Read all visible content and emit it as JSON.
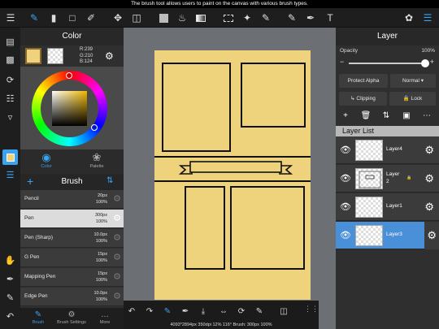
{
  "status_bar": {
    "tip": "The brush tool allows users to paint on the canvas with various brush types."
  },
  "top_toolbar": {
    "icons": [
      "menu-icon",
      "brush-tool-icon",
      "eraser-tool-icon",
      "select-rect-icon",
      "smudge-tool-icon",
      "move-tool-icon",
      "transform-tool-icon",
      "fill-color-icon",
      "bucket-fill-icon",
      "gradient-icon",
      "lasso-select-icon",
      "magic-wand-icon",
      "select-pen-icon",
      "eyedropper-icon",
      "text-tool-icon",
      "materials-icon",
      "layers-toggle-icon"
    ]
  },
  "color_panel": {
    "title": "Color",
    "rgb": {
      "r": "R:239",
      "g": "G:210",
      "b": "B:124"
    },
    "primary_color": "#efd27c",
    "tabs": [
      {
        "label": "Color"
      },
      {
        "label": "Palette"
      }
    ]
  },
  "brush_panel": {
    "title": "Brush",
    "brushes": [
      {
        "name": "Pencil",
        "size": "20px",
        "opacity": "100%",
        "selected": false
      },
      {
        "name": "Pen",
        "size": "300px",
        "opacity": "100%",
        "selected": true
      },
      {
        "name": "Pen (Sharp)",
        "size": "10.0px",
        "opacity": "100%",
        "selected": false
      },
      {
        "name": "G Pen",
        "size": "15px",
        "opacity": "100%",
        "selected": false
      },
      {
        "name": "Mapping Pen",
        "size": "15px",
        "opacity": "100%",
        "selected": false
      },
      {
        "name": "Edge Pen",
        "size": "10.0px",
        "opacity": "100%",
        "selected": false
      }
    ],
    "tabs": [
      {
        "label": "Brush"
      },
      {
        "label": "Brush Settings"
      },
      {
        "label": "More"
      }
    ]
  },
  "canvas": {
    "status": "4093*2894px 350dpi 12% 116° Brush: 300px 100%"
  },
  "layer_panel": {
    "title": "Layer",
    "opacity_label": "Opacity",
    "opacity_value": "100%",
    "opacity_fraction": 1.0,
    "protect_alpha": "Protect Alpha",
    "blend_mode": "Normal",
    "clipping": "Clipping",
    "lock": "Lock",
    "list_title": "Layer List",
    "layers": [
      {
        "name": "Layer4",
        "selected": false
      },
      {
        "name": "Layer",
        "name2": "2",
        "selected": false
      },
      {
        "name": "Layer1",
        "selected": false
      },
      {
        "name": "Layer3",
        "selected": true
      }
    ]
  },
  "colors": {
    "accent": "#3aa3f0",
    "selected_layer": "#4a90d9",
    "paper": "#efd27c"
  }
}
